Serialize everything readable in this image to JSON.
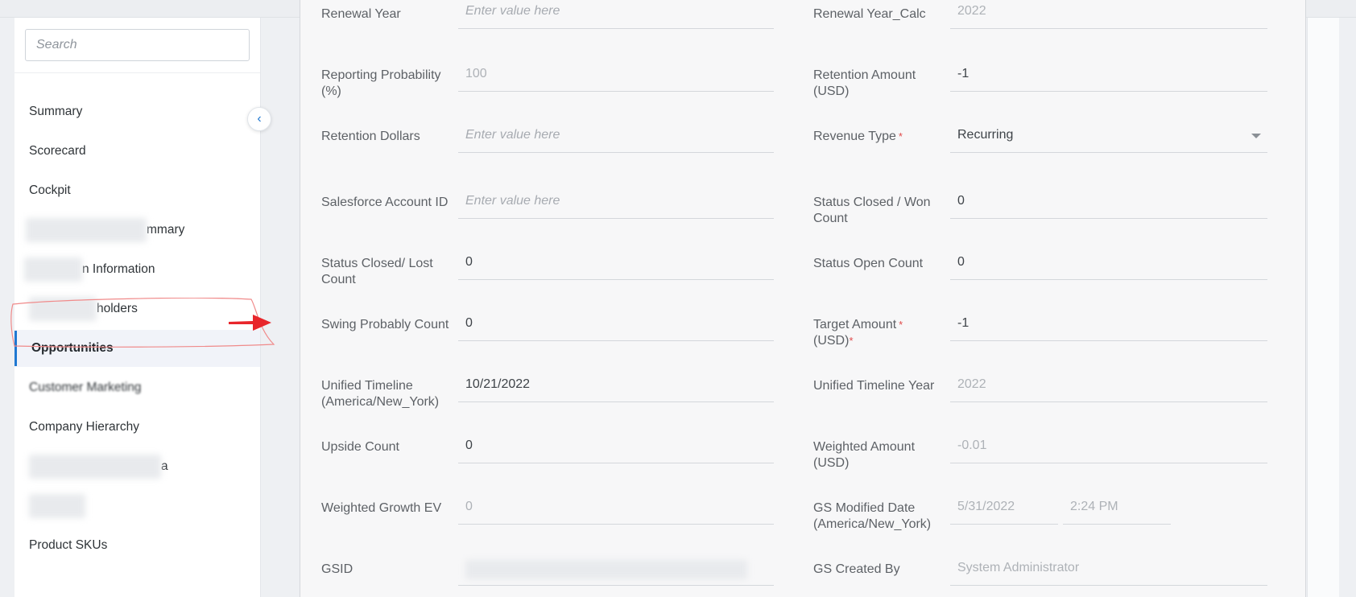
{
  "search": {
    "placeholder": "Search"
  },
  "sidebar": {
    "items": [
      {
        "label": "Summary"
      },
      {
        "label": "Scorecard"
      },
      {
        "label": "Cockpit"
      },
      {
        "label": "mmary"
      },
      {
        "label": "n Information"
      },
      {
        "label": "holders"
      },
      {
        "label": "Opportunities"
      },
      {
        "label": "Customer Marketing"
      },
      {
        "label": "Company Hierarchy"
      },
      {
        "label": "a"
      },
      {
        "label": ""
      },
      {
        "label": "Product SKUs"
      }
    ]
  },
  "form": {
    "renewal_year": {
      "label": "Renewal Year",
      "placeholder": "Enter value here"
    },
    "renewal_year_calc": {
      "label": "Renewal Year_Calc",
      "value": "2022"
    },
    "reporting_probability": {
      "label": "Reporting Probability (%)",
      "value": "100"
    },
    "retention_amount": {
      "label": "Retention Amount (USD)",
      "value": "-1"
    },
    "retention_dollars": {
      "label": "Retention Dollars",
      "placeholder": "Enter value here"
    },
    "revenue_type": {
      "label": "Revenue Type",
      "value": "Recurring"
    },
    "salesforce_account_id": {
      "label": "Salesforce Account ID",
      "placeholder": "Enter value here"
    },
    "status_closed_won": {
      "label": "Status Closed / Won Count",
      "value": "0"
    },
    "status_closed_lost": {
      "label": "Status Closed/ Lost Count",
      "value": "0"
    },
    "status_open": {
      "label": "Status Open Count",
      "value": "0"
    },
    "swing_probably": {
      "label": "Swing Probably Count",
      "value": "0"
    },
    "target_amount": {
      "label": "Target Amount",
      "label_line2": "(USD)",
      "value": "-1"
    },
    "unified_timeline": {
      "label": "Unified Timeline (America/New_York)",
      "value": "10/21/2022"
    },
    "unified_timeline_year": {
      "label": "Unified Timeline Year",
      "value": "2022"
    },
    "upside_count": {
      "label": "Upside Count",
      "value": "0"
    },
    "weighted_amount": {
      "label": "Weighted Amount (USD)",
      "value": "-0.01"
    },
    "weighted_growth_ev": {
      "label": "Weighted Growth EV",
      "value": "0"
    },
    "gs_modified_date": {
      "label": "GS Modified Date (America/New_York)",
      "date": "5/31/2022",
      "time": "2:24 PM"
    },
    "gsid": {
      "label": "GSID"
    },
    "gs_created_by": {
      "label": "GS Created By",
      "value": "System Administrator"
    }
  },
  "colors": {
    "accent": "#1f78d1",
    "required": "#e04b4b",
    "annotation": "#e8262b"
  }
}
